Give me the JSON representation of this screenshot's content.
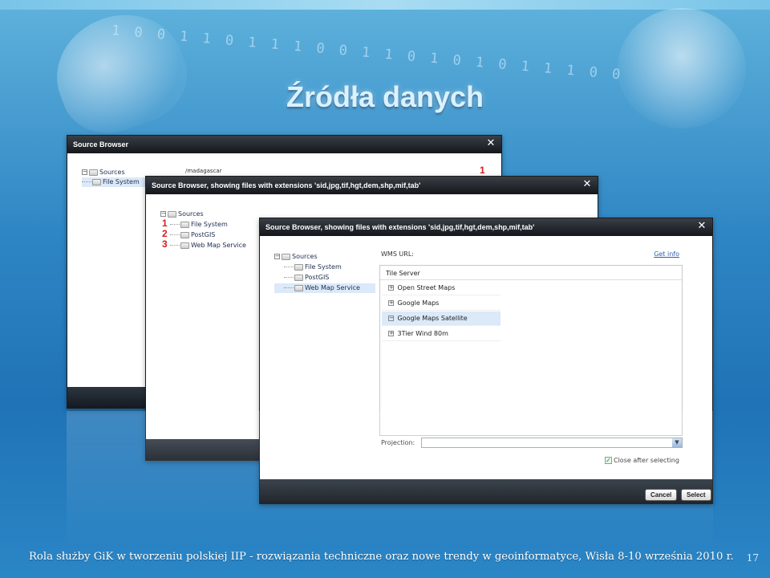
{
  "slide": {
    "title": "Źródła danych",
    "footer": "Rola służby GiK w tworzeniu polskiej IIP - rozwiązania techniczne oraz nowe trendy w geoinformatyce, Wisła 8-10 września 2010 r.",
    "page_number": "17",
    "binary_decoration": "1 0 0 1 1 0 1 1 1 0 0 1 1 0 1 0 1 0 1 1 1 0 0 1 0 1 0 1 0 1 1 0 1 1 1 0"
  },
  "window1": {
    "title": "Source Browser",
    "close": "✕",
    "path": "/madagascar",
    "tree": {
      "root": "Sources",
      "items": [
        "File System"
      ]
    },
    "marker": "1"
  },
  "window2": {
    "title": "Source Browser, showing files with extensions 'sid,jpg,tif,hgt,dem,shp,mif,tab'",
    "close": "✕",
    "tree": {
      "root": "Sources",
      "items": [
        "File System",
        "PostGIS",
        "Web Map Service"
      ]
    },
    "markers": [
      "1",
      "2",
      "3"
    ]
  },
  "window3": {
    "title": "Source Browser, showing files with extensions 'sid,jpg,tif,hgt,dem,shp,mif,tab'",
    "close": "✕",
    "tree": {
      "root": "Sources",
      "items": [
        "File System",
        "PostGIS",
        "Web Map Service"
      ]
    },
    "wms_label": "WMS URL:",
    "get_info": "Get info",
    "tile_header": "Tile Server",
    "tiles": [
      {
        "label": "Open Street Maps",
        "toggle": "+"
      },
      {
        "label": "Google Maps",
        "toggle": "+"
      },
      {
        "label": "Google Maps Satellite",
        "toggle": "−"
      },
      {
        "label": "3Tier Wind 80m",
        "toggle": "+"
      }
    ],
    "projection_label": "Projection:",
    "projection_value": "",
    "close_after_selecting": "Close after selecting",
    "cancel": "Cancel",
    "select": "Select"
  }
}
